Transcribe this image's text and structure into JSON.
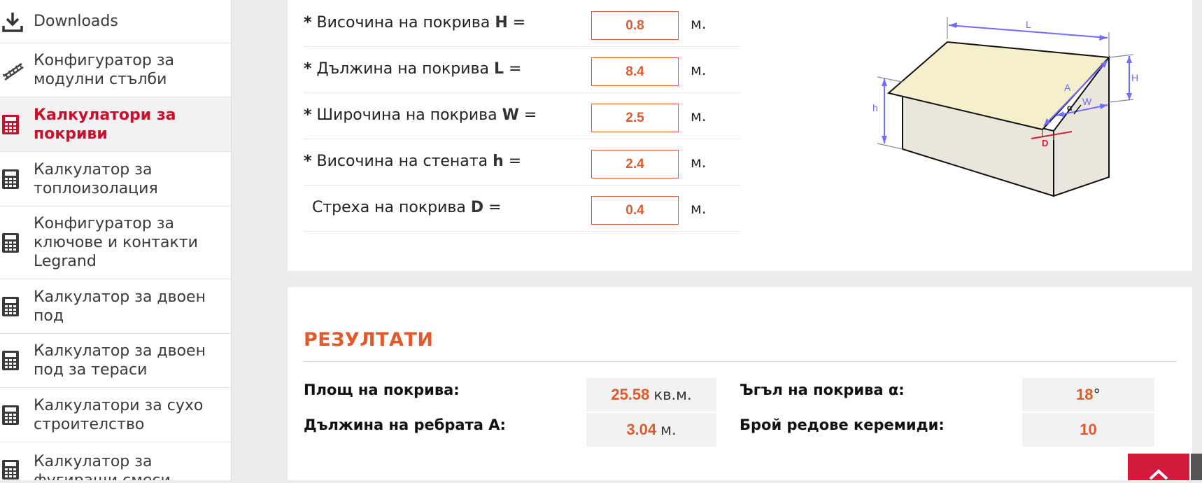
{
  "sidebar": {
    "items": [
      {
        "label": "Downloads",
        "icon": "download-icon",
        "active": false
      },
      {
        "label": "Конфигуратор за модулни стълби",
        "icon": "stairs-icon",
        "active": false
      },
      {
        "label": "Калкулатори за покриви",
        "icon": "calculator-icon",
        "active": true
      },
      {
        "label": "Калкулатор за топлоизолация",
        "icon": "calculator-icon",
        "active": false
      },
      {
        "label": "Конфигуратор за ключове и контакти Legrand",
        "icon": "calculator-icon",
        "active": false
      },
      {
        "label": "Калкулатор за двоен под",
        "icon": "calculator-icon",
        "active": false
      },
      {
        "label": "Калкулатор за двоен под за тераси",
        "icon": "calculator-icon",
        "active": false
      },
      {
        "label": "Калкулатори за сухо строителство",
        "icon": "calculator-icon",
        "active": false
      },
      {
        "label": "Калкулатор за фугиращи смеси",
        "icon": "calculator-icon",
        "active": false
      }
    ]
  },
  "inputs": [
    {
      "required": "*",
      "text": "Височина на покрива",
      "symbol": "H",
      "eq": "=",
      "value": "0.8",
      "unit": "м."
    },
    {
      "required": "*",
      "text": "Дължина на покрива",
      "symbol": "L",
      "eq": "=",
      "value": "8.4",
      "unit": "м."
    },
    {
      "required": "*",
      "text": "Широчина на покрива",
      "symbol": "W",
      "eq": "=",
      "value": "2.5",
      "unit": "м."
    },
    {
      "required": "*",
      "text": "Височина на стената",
      "symbol": "h",
      "eq": "=",
      "value": "2.4",
      "unit": "м."
    },
    {
      "required": "",
      "text": "Стреха на покрива",
      "symbol": "D",
      "eq": "=",
      "value": "0.4",
      "unit": "м."
    }
  ],
  "diagram": {
    "labels": {
      "L": "L",
      "H": "H",
      "h": "h",
      "A": "A",
      "W": "W",
      "alpha": "α",
      "D": "D"
    },
    "colors": {
      "roof": "#f5efcb",
      "wall": "#eae6dc",
      "dimension": "#6f6cff",
      "eave": "#d41a3c"
    }
  },
  "results": {
    "title": "РЕЗУЛТАТИ",
    "roof_area": {
      "label": "Площ на покрива:",
      "value": "25.58",
      "unit": "кв.м."
    },
    "rafter_length": {
      "label": "Дължина на ребрата А:",
      "value": "3.04",
      "unit": "м."
    },
    "roof_angle": {
      "label": "Ъгъл на покрива α:",
      "value": "18",
      "unit": "°"
    },
    "tile_rows": {
      "label": "Брой редове керемиди:",
      "value": "10",
      "unit": ""
    }
  },
  "colors": {
    "accent": "#e05a2b",
    "brand": "#c8102e",
    "scroll_top": "#d41a3c"
  }
}
